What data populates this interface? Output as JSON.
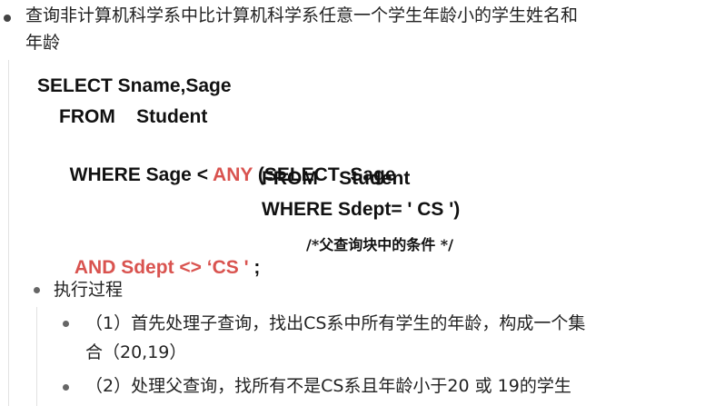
{
  "bullet1": {
    "line1": "查询非计算机科学系中比计算机科学系任意一个学生年龄小的学生姓名和",
    "line2": "年龄"
  },
  "sql": {
    "l1": "SELECT Sname,Sage",
    "l2": "FROM    Student",
    "l3_pre": "WHERE Sage < ",
    "l3_kw": "ANY",
    "l3_post": " (SELECT  Sage",
    "l4": "FROM    Student",
    "l5": "WHERE Sdept= ' CS ')",
    "l6_red": "AND Sdept <> ‘CS '",
    "l6_semi": " ;",
    "comment": "/*父查询块中的条件 */"
  },
  "bullet2": {
    "label": "执行过程"
  },
  "steps": [
    {
      "line1": "（1）首先处理子查询，找出CS系中所有学生的年龄，构成一个集",
      "line2": "合（20,19）"
    },
    {
      "line1": "（2）处理父查询，找所有不是CS系且年龄小于20 或 19的学生"
    }
  ]
}
